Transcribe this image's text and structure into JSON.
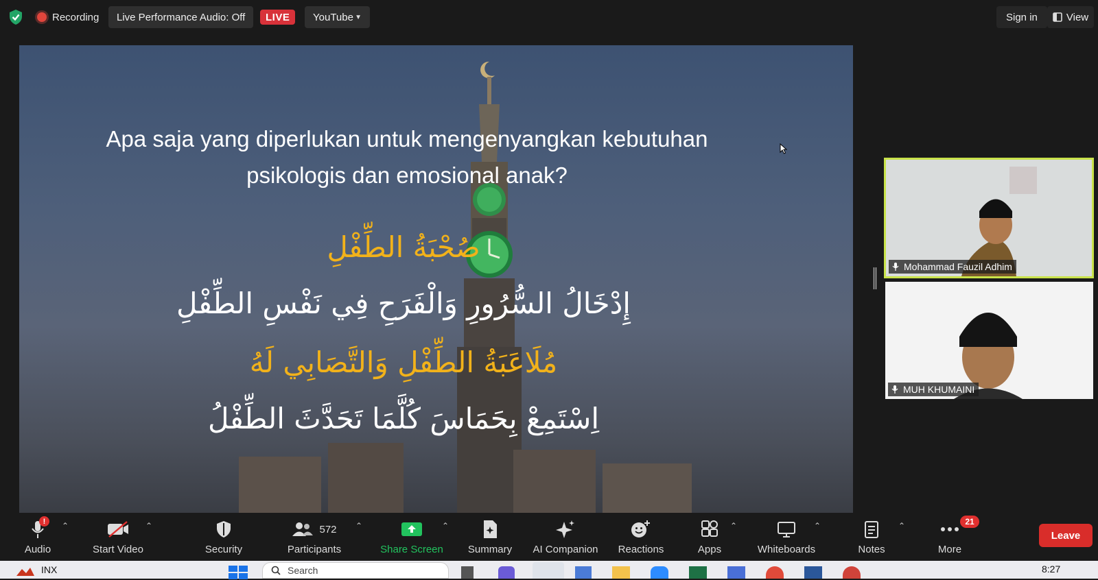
{
  "topbar": {
    "recording": "Recording",
    "live_audio": "Live Performance Audio: Off",
    "live": "LIVE",
    "platform": "YouTube",
    "sign_in": "Sign in",
    "view": "View"
  },
  "slide": {
    "title_line1": "Apa saja yang diperlukan untuk mengenyangkan kebutuhan",
    "title_line2": "psikologis dan emosional anak?",
    "arabic_1": "صُحْبَةُ الطِّفْلِ",
    "arabic_2": "إِدْخَالُ السُّرُورِ وَالْفَرَحِ فِي نَفْسِ الطِّفْلِ",
    "arabic_3": "مُلَاعَبَةُ الطِّفْلِ وَالتَّصَابِي لَهُ",
    "arabic_4": "اِسْتَمِعْ بِحَمَاسَ كُلَّمَا تَحَدَّثَ الطِّفْلُ",
    "accent_color": "#f2b21a"
  },
  "participants_videos": [
    {
      "name": "Mohammad Fauzil Adhim",
      "active_speaker": true
    },
    {
      "name": "MUH KHUMAINI",
      "active_speaker": false
    }
  ],
  "toolbar": {
    "audio": "Audio",
    "start_video": "Start Video",
    "security": "Security",
    "participants": "Participants",
    "participants_count": "572",
    "share_screen": "Share Screen",
    "summary": "Summary",
    "ai_companion": "AI Companion",
    "reactions": "Reactions",
    "apps": "Apps",
    "whiteboards": "Whiteboards",
    "notes": "Notes",
    "more": "More",
    "more_badge": "21",
    "audio_badge": "!",
    "leave": "Leave",
    "share_color": "#22c35e"
  },
  "taskbar": {
    "left_label": "INX",
    "search_placeholder": "Search",
    "time": "8:27"
  }
}
